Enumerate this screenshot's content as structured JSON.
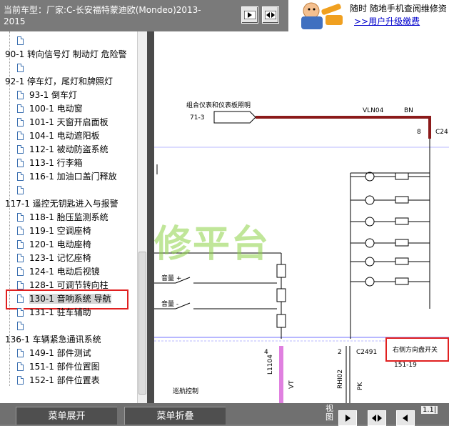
{
  "header": {
    "vehicle": "当前车型：厂家:C-长安福特蒙迪欧(Mondeo)2013-2015"
  },
  "ad": {
    "line1": "随时 随地手机查阅维修资",
    "link": ">>用户升级缴费"
  },
  "tree": {
    "items": [
      {
        "label": "",
        "icon": "doc-icon"
      },
      {
        "label": "90-1 转向信号灯 制动灯 危险警",
        "icon": "none"
      },
      {
        "label": "",
        "icon": "doc-icon"
      },
      {
        "label": "92-1 停车灯，尾灯和牌照灯",
        "icon": "none"
      },
      {
        "label": "93-1 倒车灯",
        "icon": "doc-icon"
      },
      {
        "label": "100-1 电动窗",
        "icon": "doc-icon"
      },
      {
        "label": "101-1 天窗开启面板",
        "icon": "doc-icon"
      },
      {
        "label": "104-1 电动遮阳板",
        "icon": "doc-icon"
      },
      {
        "label": "112-1 被动防盗系统",
        "icon": "doc-icon"
      },
      {
        "label": "113-1 行李箱",
        "icon": "doc-icon"
      },
      {
        "label": "116-1 加油口盖门释放",
        "icon": "doc-icon"
      },
      {
        "label": "",
        "icon": "doc-icon"
      },
      {
        "label": "117-1 遥控无钥匙进入与报警",
        "icon": "none"
      },
      {
        "label": "118-1 胎压监测系统",
        "icon": "doc-icon"
      },
      {
        "label": "119-1 空调座椅",
        "icon": "doc-icon"
      },
      {
        "label": "120-1 电动座椅",
        "icon": "doc-icon"
      },
      {
        "label": "123-1 记忆座椅",
        "icon": "doc-icon"
      },
      {
        "label": "124-1 电动后视镜",
        "icon": "doc-icon"
      },
      {
        "label": "128-1 可调节转向柱",
        "icon": "doc-icon"
      },
      {
        "label": "130-1 音响系统 导航",
        "icon": "doc-icon",
        "selected": true
      },
      {
        "label": "131-1 驻车辅助",
        "icon": "doc-icon"
      },
      {
        "label": "",
        "icon": "doc-icon"
      },
      {
        "label": "136-1 车辆紧急通讯系统",
        "icon": "none"
      },
      {
        "label": "149-1 部件测试",
        "icon": "doc-icon"
      },
      {
        "label": "151-1 部件位置图",
        "icon": "doc-icon"
      },
      {
        "label": "152-1 部件位置表",
        "icon": "doc-icon"
      }
    ]
  },
  "diagram": {
    "connector_title": "组合仪表和仪表板照明",
    "connector_id": "71-3",
    "wire_name": "VLN04",
    "wire_color": "BN",
    "pin_top": "8",
    "conn_top": "C24",
    "switch_plus": "音量 +",
    "switch_minus": "音量 -",
    "watermark": "修平台",
    "pin_left": "4",
    "pin_right": "2",
    "conn_bottom": "C2491",
    "callout": "右侧方向盘开关",
    "callout_ref": "151-19",
    "wire_left": "L1104",
    "wire_left_color": "VT",
    "wire_right": "RHI02",
    "wire_right_color": "PK",
    "footer_label": "巡航控制",
    "colors": {
      "wire_brown": "#8b1a1a",
      "wire_violet": "#e080e0",
      "highlight": "#e02020"
    }
  },
  "bottom": {
    "expand": "菜单展开",
    "collapse": "菜单折叠",
    "view_label": "视图",
    "zoom": "1.1|"
  }
}
